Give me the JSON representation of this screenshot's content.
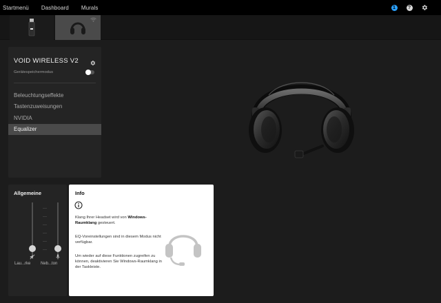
{
  "nav": {
    "items": [
      "Startmenü",
      "Dashboard",
      "Murals"
    ],
    "notification_count": "1",
    "help_symbol": "?"
  },
  "devices": [
    {
      "icon": "wireless-dongle-icon"
    },
    {
      "icon": "headset-icon",
      "selected": true
    }
  ],
  "device_panel": {
    "title": "VOID WIRELESS V2",
    "mode_label": "Gerätespeichermodus",
    "mode_toggle_on": false,
    "menu": [
      {
        "label": "Beleuchtungseffekte"
      },
      {
        "label": "Tastenzuweisungen"
      },
      {
        "label": "NVIDIA"
      },
      {
        "label": "Equalizer",
        "active": true
      }
    ]
  },
  "general": {
    "title": "Allgemeine",
    "sliders": [
      {
        "label": "Lau...rke",
        "icon": "volume-muted-icon",
        "level": 0
      },
      {
        "label": "Neb...ton",
        "icon": "microphone-icon",
        "level": 0
      }
    ]
  },
  "info": {
    "title": "Info",
    "p1_pre": "Klang Ihrer Headset wird von ",
    "p1_bold": "Windows-Raumklang",
    "p1_post": " gesteuert.",
    "p2": "EQ-Voreinstellungen sind in diesem Modus nicht verfügbar.",
    "p3": "Um wieder auf diese Funktionen zugreifen zu können, deaktivieren Sie Windows-Raumklang in der Taskleiste."
  },
  "colors": {
    "background": "#1c1c1c",
    "panel": "#242424",
    "active_item": "#4a4a4a",
    "accent_badge": "#2aa1ff",
    "info_panel": "#ffffff"
  }
}
